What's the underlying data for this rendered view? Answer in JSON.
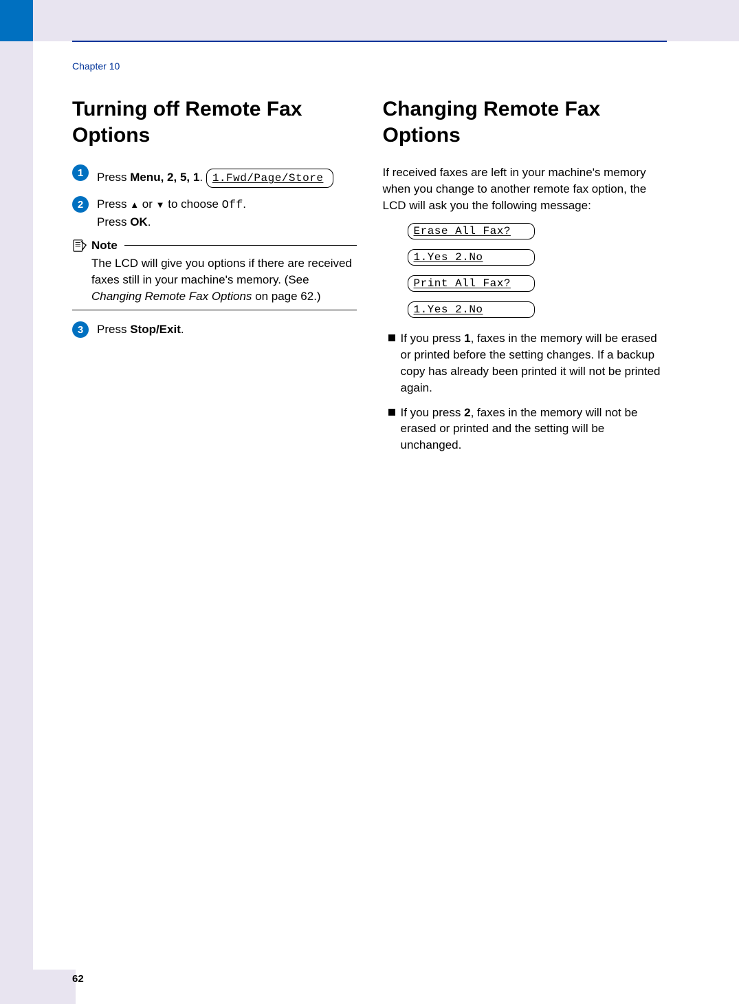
{
  "header": {
    "chapter": "Chapter 10"
  },
  "left": {
    "heading": "Turning off Remote Fax Options",
    "step1_prefix": "Press ",
    "step1_keys": "Menu, 2, 5, 1",
    "step1_suffix": ".",
    "lcd1": "1.Fwd/Page/Store",
    "step2_prefix": "Press ",
    "step2_mid": " to choose ",
    "step2_off": "Off",
    "step2_suffix": ".",
    "step2_line2a": "Press ",
    "step2_line2b": "OK",
    "step2_line2c": ".",
    "note_label": "Note",
    "note_text1": "The LCD will give you options if there are received faxes still in your machine's memory. (See ",
    "note_text_italic": "Changing Remote Fax Options",
    "note_text2": " on page 62.)",
    "step3_prefix": "Press ",
    "step3_key": "Stop/Exit",
    "step3_suffix": "."
  },
  "right": {
    "heading": "Changing Remote Fax Options",
    "intro": "If received faxes are left in your machine's memory when you change to another remote fax option, the LCD will ask you the following message:",
    "lcd_a": "Erase All Fax?",
    "lcd_b": "1.Yes 2.No",
    "lcd_c": "Print All Fax?",
    "lcd_d": "1.Yes 2.No",
    "bullet1_a": "If you press ",
    "bullet1_key": "1",
    "bullet1_b": ", faxes in the memory will be erased or printed before the setting changes. If a backup copy has already been printed it will not be printed again.",
    "bullet2_a": "If you press ",
    "bullet2_key": "2",
    "bullet2_b": ", faxes in the memory will not be erased or printed and the setting will be unchanged."
  },
  "footer": {
    "page": "62"
  }
}
